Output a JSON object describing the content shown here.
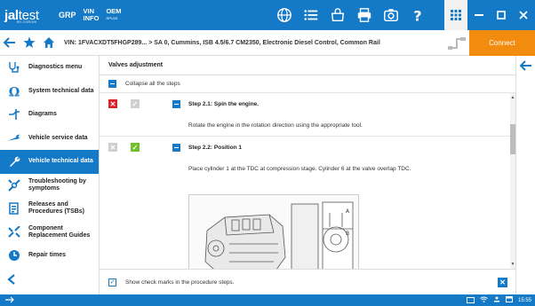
{
  "brand": {
    "name_bold": "jal",
    "name_light": "test",
    "sub": "BY CORGHI"
  },
  "topbar": {
    "grp": "GRP",
    "vin": {
      "top": "VIN",
      "bottom": "INFO"
    },
    "oem": {
      "top": "OEM",
      "bottom": "RPU25"
    }
  },
  "vehicle": {
    "vin_label": "VIN:",
    "vin": "1FVACXDT5FHGP289...",
    "separator": ">",
    "description": "SA 0, Cummins, ISB 4.5/6.7 CM2350, Electronic Diesel Control, Common Rail"
  },
  "connect_label": "Connect",
  "sidebar": {
    "items": [
      {
        "label": "Diagnostics menu",
        "icon": "diagnostics-icon"
      },
      {
        "label": "System technical data",
        "icon": "omega-icon"
      },
      {
        "label": "Diagrams",
        "icon": "diagrams-icon"
      },
      {
        "label": "Vehicle service data",
        "icon": "wrench-icon"
      },
      {
        "label": "Vehicle technical data",
        "icon": "wrench-blue-icon"
      },
      {
        "label": "Troubleshooting by symptoms",
        "icon": "troubleshoot-icon"
      },
      {
        "label": "Releases and Procedures (TSBs)",
        "icon": "releases-icon"
      },
      {
        "label": "Component Replacement Guides",
        "icon": "component-icon"
      },
      {
        "label": "Repair times",
        "icon": "clock-icon"
      }
    ]
  },
  "main": {
    "title": "Valves adjustment",
    "collapse_label": "Collapse all the steps",
    "steps": [
      {
        "title": "Step 2.1: Spin the engine.",
        "description": "Rotate the engine in the rotation direction using the appropriate tool."
      },
      {
        "title": "Step 2.2: Position 1",
        "description": "Place cylinder 1 at the TDC at compression stage. Cylinder 6 at the valve overlap TDC."
      }
    ],
    "footer_label": "Show check marks in the procedure steps."
  },
  "statusbar": {
    "time": "15:55"
  },
  "colors": {
    "brand_blue": "#1479c6",
    "connect_orange": "#f28c0f",
    "red": "#d9252a",
    "green": "#70c02c"
  }
}
